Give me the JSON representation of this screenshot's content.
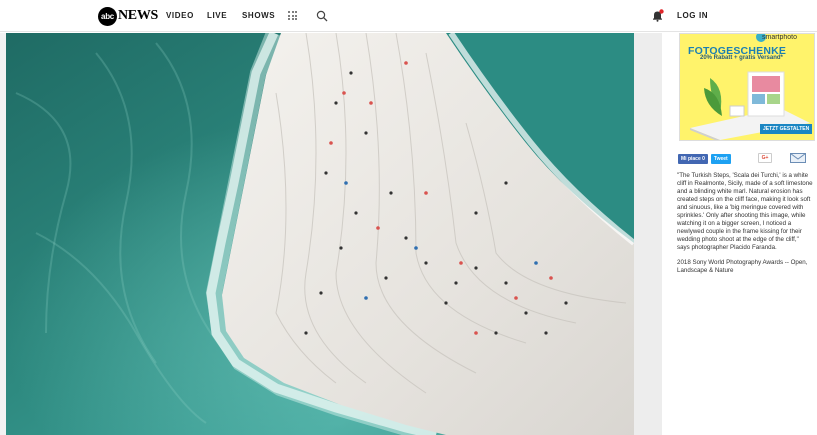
{
  "nav": {
    "logo_mark": "abc",
    "logo_word": "NEWS",
    "video": "VIDEO",
    "live": "LIVE",
    "shows": "SHOWS",
    "login": "LOG IN",
    "icons": [
      "menu-grid-icon",
      "search-icon",
      "notification-bell-icon"
    ]
  },
  "ad": {
    "brand": "smartphoto",
    "headline": "FOTOGESCHENKE",
    "subline": "20% Rabatt + gratis Versand*",
    "cta": "JETZT GESTALTEN"
  },
  "share": {
    "like": "Mi piace 0",
    "tweet": "Tweet",
    "gplus": "G+",
    "mail_icon": "mail-icon"
  },
  "caption": "\"The Turkish Steps, 'Scala dei Turchi,' is a white cliff in Realmonte, Sicily, made of a soft limestone and a blinding white marl. Natural erosion has created steps on the cliff face, making it look soft and sinuous, like a 'big meringue covered with sprinkles.' Only after shooting this image, while watching it on a bigger screen, I noticed a newlywed couple in the frame kissing for their wedding photo shoot at the edge of the cliff,\" says photographer Placido Faranda.",
  "credit": "2018 Sony World Photography Awards -- Open, Landscape & Nature",
  "colors": {
    "sea_deep": "#1f6b64",
    "sea_light": "#3fa39a",
    "cliff": "#ece9e4",
    "notification": "#e0272b",
    "ad_bg": "#fff36b"
  }
}
